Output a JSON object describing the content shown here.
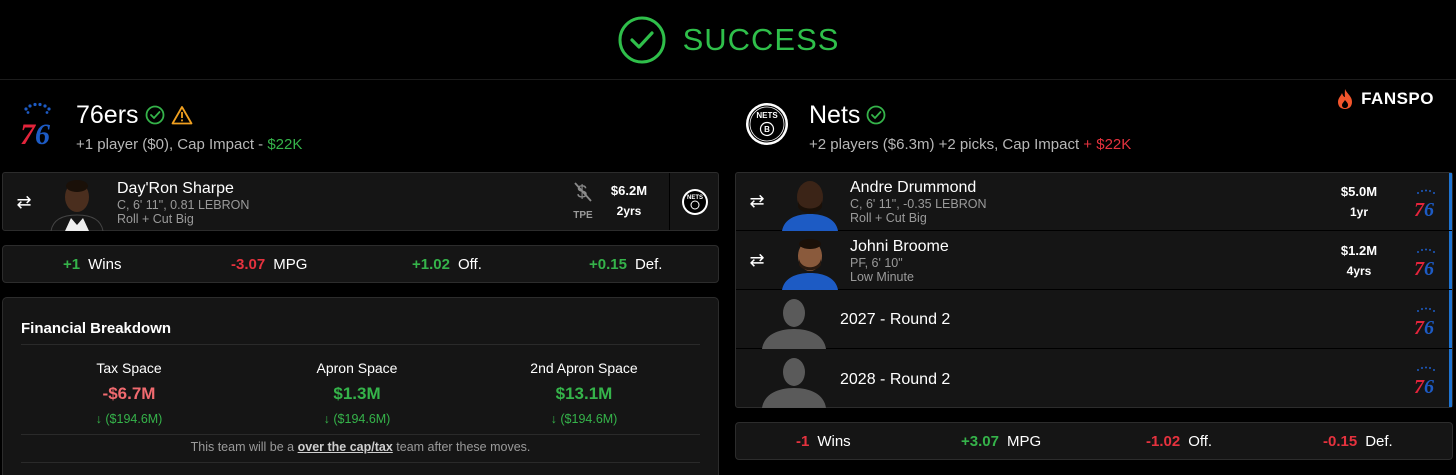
{
  "status": {
    "text": "SUCCESS",
    "color": "#2fbf4a"
  },
  "brand": {
    "name": "FANSPO"
  },
  "left_team": {
    "name": "76ers",
    "subtitle_prefix": "+1 player ($0), Cap Impact -",
    "cap_impact": "$22K",
    "player": {
      "name": "Day'Ron Sharpe",
      "meta1": "C, 6' 11\", 0.81 LEBRON",
      "meta2": "Roll + Cut Big",
      "tpe_label": "TPE",
      "salary": "$6.2M",
      "years": "2yrs"
    },
    "stats": [
      {
        "value": "+1",
        "label": "Wins"
      },
      {
        "value": "-3.07",
        "label": "MPG"
      },
      {
        "value": "+1.02",
        "label": "Off."
      },
      {
        "value": "+0.15",
        "label": "Def."
      }
    ],
    "financial": {
      "title": "Financial Breakdown",
      "columns": [
        {
          "label": "Tax Space",
          "value": "-$6.7M",
          "delta": "($194.6M)"
        },
        {
          "label": "Apron Space",
          "value": "$1.3M",
          "delta": "($194.6M)"
        },
        {
          "label": "2nd Apron Space",
          "value": "$13.1M",
          "delta": "($194.6M)"
        }
      ],
      "note_prefix": "This team will be a",
      "note_bold": "over the cap/tax",
      "note_suffix": "team after these moves."
    }
  },
  "right_team": {
    "name": "Nets",
    "subtitle_prefix": "+2 players ($6.3m) +2 picks, Cap Impact",
    "cap_impact": "+ $22K",
    "players": [
      {
        "name": "Andre Drummond",
        "meta1": "C, 6' 11\", -0.35 LEBRON",
        "meta2": "Roll + Cut Big",
        "salary": "$5.0M",
        "years": "1yr"
      },
      {
        "name": "Johni Broome",
        "meta1": "PF, 6' 10\"",
        "meta2": "Low Minute",
        "salary": "$1.2M",
        "years": "4yrs"
      }
    ],
    "picks": [
      {
        "label": "2027 - Round 2"
      },
      {
        "label": "2028 - Round 2"
      }
    ],
    "stats": [
      {
        "value": "-1",
        "label": "Wins"
      },
      {
        "value": "+3.07",
        "label": "MPG"
      },
      {
        "value": "-1.02",
        "label": "Off."
      },
      {
        "value": "-0.15",
        "label": "Def."
      }
    ]
  }
}
